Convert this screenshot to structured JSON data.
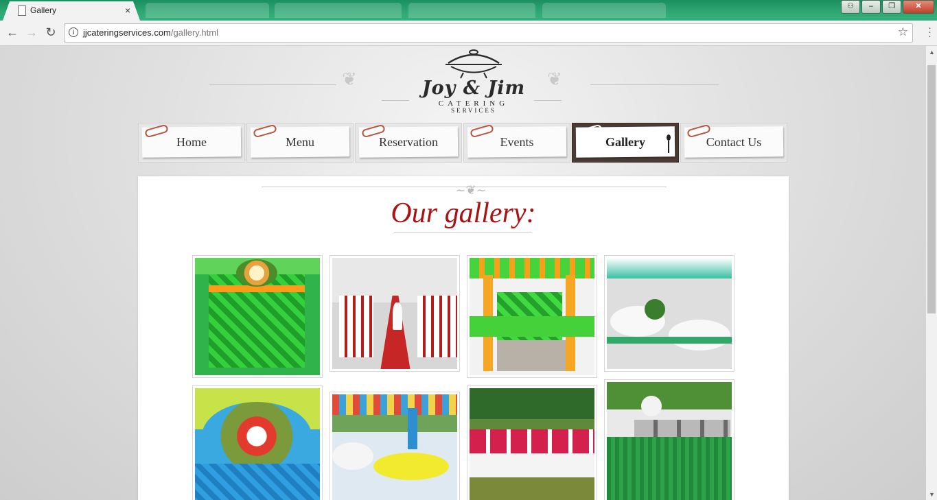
{
  "browser": {
    "tab_title": "Gallery",
    "tab_close": "×",
    "url_domain": "jjcateringservices.com",
    "url_path": "/gallery.html",
    "info_glyph": "i",
    "star_glyph": "☆",
    "back_glyph": "←",
    "forward_glyph": "→",
    "reload_glyph": "↻",
    "win_minimize": "–",
    "win_maximize": "❐",
    "win_close": "✕"
  },
  "logo": {
    "script": "Joy & Jim",
    "line1": "CATERING",
    "line2": "SERVICES"
  },
  "nav": {
    "items": [
      {
        "label": "Home"
      },
      {
        "label": "Menu"
      },
      {
        "label": "Reservation"
      },
      {
        "label": "Events"
      },
      {
        "label": "Gallery",
        "active": true
      },
      {
        "label": "Contact Us"
      }
    ]
  },
  "gallery": {
    "heading": "Our gallery:",
    "photos": [
      {
        "subject": "green-skirted-table-with-flowers"
      },
      {
        "subject": "wedding-aisle-red-carpet"
      },
      {
        "subject": "green-orange-stage-arch"
      },
      {
        "subject": "tent-reception-teal-white"
      },
      {
        "subject": "blue-table-flower-arrangement"
      },
      {
        "subject": "garden-tables-yellow-blue"
      },
      {
        "subject": "outdoor-tables-red-white"
      },
      {
        "subject": "buffet-chafing-dishes"
      }
    ]
  },
  "colors": {
    "heading": "#a81414",
    "nav_active": "#4a3b34",
    "tab_strip": "#2fa874"
  }
}
